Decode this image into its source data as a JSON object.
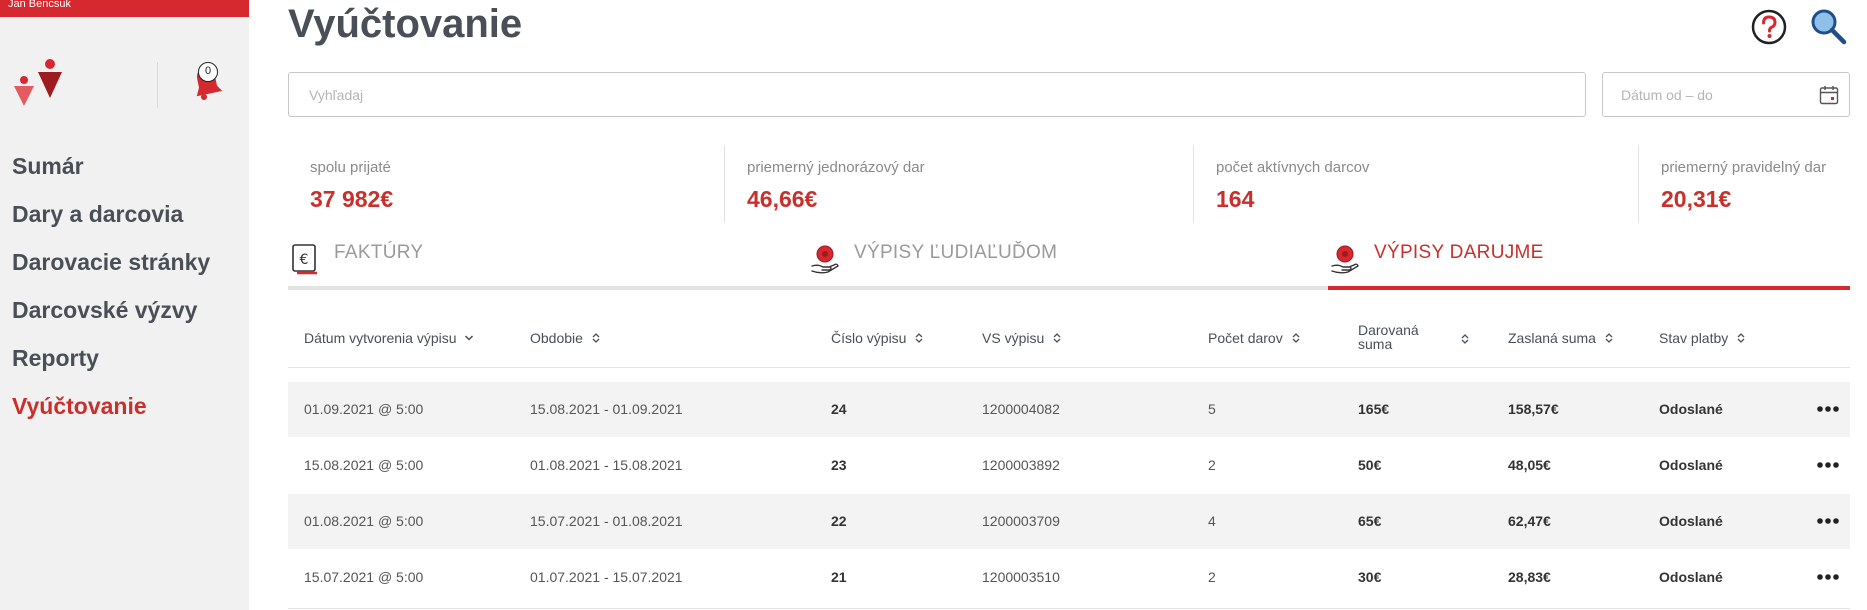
{
  "sidebar": {
    "topbar_text": "Jan Bencsuk",
    "notification_count": "0",
    "items": [
      {
        "label": "Sumár",
        "active": false
      },
      {
        "label": "Dary a darcovia",
        "active": false
      },
      {
        "label": "Darovacie stránky",
        "active": false
      },
      {
        "label": "Darcovské výzvy",
        "active": false
      },
      {
        "label": "Reporty",
        "active": false
      },
      {
        "label": "Vyúčtovanie",
        "active": true
      }
    ]
  },
  "header": {
    "title": "Vyúčtovanie"
  },
  "search": {
    "placeholder": "Vyhľadaj",
    "date_placeholder": "Dátum od – do"
  },
  "stats": [
    {
      "label": "spolu prijaté",
      "value": "37 982€"
    },
    {
      "label": "priemerný jednorázový dar",
      "value": "46,66€"
    },
    {
      "label": "počet aktívnych darcov",
      "value": "164"
    },
    {
      "label": "priemerný pravidelný dar",
      "value": "20,31€"
    }
  ],
  "tabs": [
    {
      "label": "FAKTÚRY",
      "icon": "invoice-euro-icon",
      "active": false
    },
    {
      "label": "VÝPISY ĽUDIAĽUĎOM",
      "icon": "hand-coin-icon",
      "active": false
    },
    {
      "label": "VÝPISY DARUJME",
      "icon": "hand-coin-icon",
      "active": true
    }
  ],
  "table": {
    "columns": [
      {
        "label": "Dátum vytvorenia výpisu",
        "sort": "desc"
      },
      {
        "label": "Obdobie",
        "sort": "both"
      },
      {
        "label": "Číslo výpisu",
        "sort": "both"
      },
      {
        "label": "VS výpisu",
        "sort": "both"
      },
      {
        "label": "Počet darov",
        "sort": "both"
      },
      {
        "label": "Darovaná suma",
        "sort": "both"
      },
      {
        "label": "Zaslaná suma",
        "sort": "both"
      },
      {
        "label": "Stav platby",
        "sort": "both"
      }
    ],
    "rows": [
      {
        "date": "01.09.2021 @ 5:00",
        "period": "15.08.2021 - 01.09.2021",
        "number": "24",
        "vs": "1200004082",
        "count": "5",
        "donated": "165€",
        "sent": "158,57€",
        "status": "Odoslané"
      },
      {
        "date": "15.08.2021 @ 5:00",
        "period": "01.08.2021 - 15.08.2021",
        "number": "23",
        "vs": "1200003892",
        "count": "2",
        "donated": "50€",
        "sent": "48,05€",
        "status": "Odoslané"
      },
      {
        "date": "01.08.2021 @ 5:00",
        "period": "15.07.2021 - 01.08.2021",
        "number": "22",
        "vs": "1200003709",
        "count": "4",
        "donated": "65€",
        "sent": "62,47€",
        "status": "Odoslané"
      },
      {
        "date": "15.07.2021 @ 5:00",
        "period": "01.07.2021 - 15.07.2021",
        "number": "21",
        "vs": "1200003510",
        "count": "2",
        "donated": "30€",
        "sent": "28,83€",
        "status": "Odoslané"
      }
    ]
  },
  "colors": {
    "accent": "#d6282f",
    "accent_text": "#c9302c",
    "sidebar_bg": "#f1f1f1",
    "text": "#4a4f57",
    "muted": "#8a8a8a"
  }
}
